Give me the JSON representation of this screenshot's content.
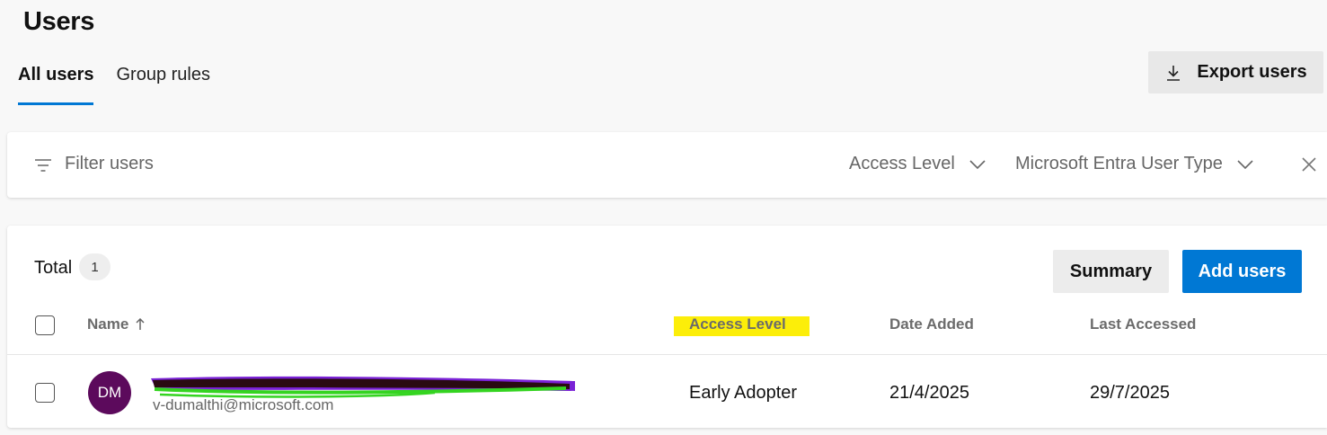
{
  "page": {
    "title": "Users"
  },
  "tabs": [
    {
      "label": "All users",
      "active": true
    },
    {
      "label": "Group rules",
      "active": false
    }
  ],
  "toolbar": {
    "export_label": "Export users",
    "export_icon": "download-icon"
  },
  "filter": {
    "placeholder": "Filter users",
    "icon": "filter-icon",
    "dropdowns": [
      {
        "label": "Access Level"
      },
      {
        "label": "Microsoft Entra User Type"
      }
    ]
  },
  "users": {
    "total_label": "Total",
    "total_count": "1",
    "summary_label": "Summary",
    "add_label": "Add users",
    "columns": {
      "name": "Name",
      "access": "Access Level",
      "date_added": "Date Added",
      "last_accessed": "Last Accessed"
    },
    "rows": [
      {
        "initials": "DM",
        "email": "v-dumalthi@microsoft.com",
        "access_level": "Early Adopter",
        "date_added": "21/4/2025",
        "last_accessed": "29/7/2025",
        "avatar_color": "#5c0a5c"
      }
    ]
  },
  "colors": {
    "accent": "#0078d4",
    "highlight": "#fcee09",
    "redaction_dark": "#2a0a12",
    "redaction_purple": "#7a22d6",
    "redaction_green": "#34d420"
  }
}
